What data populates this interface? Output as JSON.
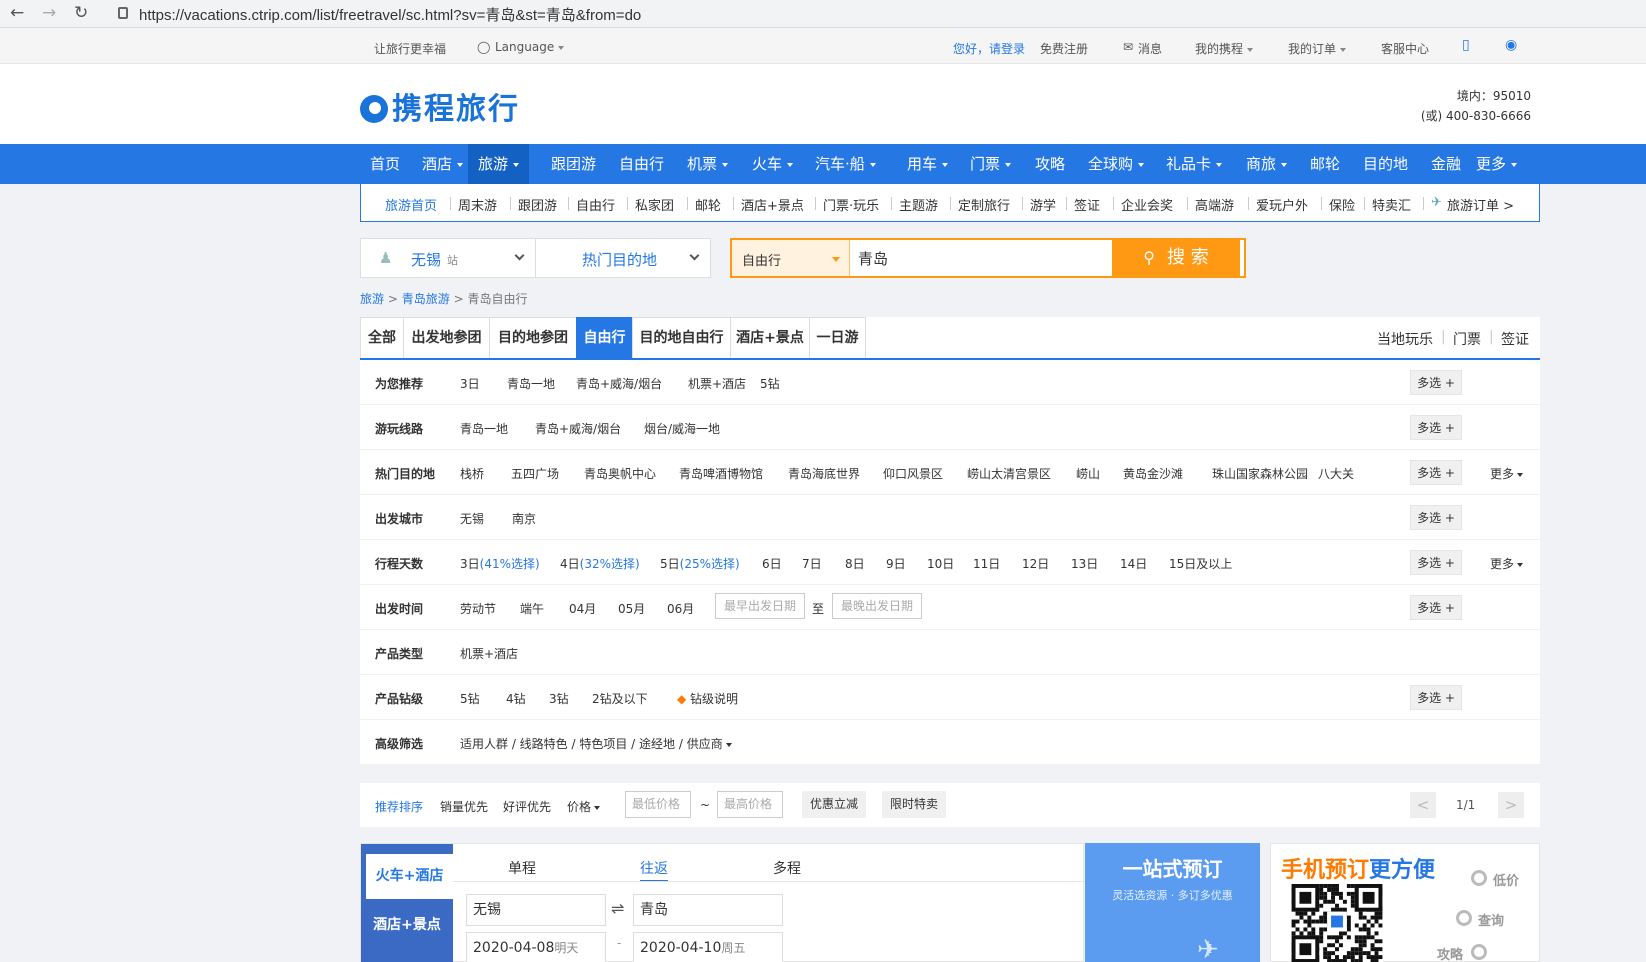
{
  "browser": {
    "url": "https://vacations.ctrip.com/list/freetravel/sc.html?sv=青岛&st=青岛&from=do"
  },
  "topbar": {
    "slogan": "让旅行更幸福",
    "language": "Language",
    "login": "您好，请登录",
    "register": "免费注册",
    "messages": "消息",
    "my_ctrip": "我的携程",
    "my_orders": "我的订单",
    "service": "客服中心"
  },
  "header": {
    "logo": "携程旅行",
    "phone_domestic": "境内：95010",
    "phone_alt": "(或) 400-830-6666"
  },
  "mainnav": {
    "items": [
      "首页",
      "酒店",
      "旅游",
      "跟团游",
      "自由行",
      "机票",
      "火车",
      "汽车·船",
      "用车",
      "门票",
      "攻略",
      "全球购",
      "礼品卡",
      "商旅",
      "邮轮",
      "目的地",
      "金融",
      "更多"
    ]
  },
  "subnav": {
    "items": [
      "旅游首页",
      "周末游",
      "跟团游",
      "自由行",
      "私家团",
      "邮轮",
      "酒店+景点",
      "门票·玩乐",
      "主题游",
      "定制旅行",
      "游学",
      "签证",
      "企业会奖",
      "高端游",
      "爱玩户外",
      "保险",
      "特卖汇",
      "旅游订单 >"
    ]
  },
  "search": {
    "city": "无锡",
    "city_suffix": "站",
    "hot_dest": "热门目的地",
    "type": "自由行",
    "query": "青岛",
    "button": "搜 索"
  },
  "breadcrumb": {
    "a": "旅游",
    "b": "青岛旅游",
    "c": "青岛自由行",
    "sep": ">"
  },
  "tabs": {
    "items": [
      "全部",
      "出发地参团",
      "目的地参团",
      "自由行",
      "目的地自由行",
      "酒店+景点",
      "一日游"
    ],
    "right": [
      "当地玩乐",
      "门票",
      "签证"
    ]
  },
  "filters": {
    "multi": "多选 +",
    "more": "更多",
    "to": "至",
    "date_start": "最早出发日期",
    "date_end": "最晚出发日期",
    "rows": [
      {
        "label": "为您推荐",
        "options": [
          "3日",
          "青岛一地",
          "青岛+威海/烟台",
          "机票+酒店",
          "5钻"
        ]
      },
      {
        "label": "游玩线路",
        "options": [
          "青岛一地",
          "青岛+威海/烟台",
          "烟台/威海一地"
        ]
      },
      {
        "label": "热门目的地",
        "options": [
          "栈桥",
          "五四广场",
          "青岛奥帆中心",
          "青岛啤酒博物馆",
          "青岛海底世界",
          "仰口风景区",
          "崂山太清宫景区",
          "崂山",
          "黄岛金沙滩",
          "珠山国家森林公园",
          "八大关"
        ]
      },
      {
        "label": "出发城市",
        "options": [
          "无锡",
          "南京"
        ]
      },
      {
        "label": "行程天数",
        "options": [
          "3日",
          "4日",
          "5日",
          "6日",
          "7日",
          "8日",
          "9日",
          "10日",
          "11日",
          "12日",
          "13日",
          "14日",
          "15日及以上"
        ],
        "pcts": [
          "(41%选择)",
          "(32%选择)",
          "(25%选择)"
        ]
      },
      {
        "label": "出发时间",
        "options": [
          "劳动节",
          "端午",
          "04月",
          "05月",
          "06月"
        ]
      },
      {
        "label": "产品类型",
        "options": [
          "机票+酒店"
        ]
      },
      {
        "label": "产品钻级",
        "options": [
          "5钻",
          "4钻",
          "3钻",
          "2钻及以下",
          "钻级说明"
        ]
      },
      {
        "label": "高级筛选",
        "options": [
          "适用人群 / 线路特色 / 特色项目 / 途经地 / 供应商"
        ]
      }
    ]
  },
  "sortbar": {
    "items": [
      "推荐排序",
      "销量优先",
      "好评优先",
      "价格"
    ],
    "min_price": "最低价格",
    "max_price": "最高价格",
    "tilde": "~",
    "tags": [
      "优惠立减",
      "限时特卖"
    ],
    "page": "1/1",
    "prev": "<",
    "next": ">"
  },
  "booking": {
    "side_a": "火车+酒店",
    "side_b": "酒店+景点",
    "trip_types": [
      "单程",
      "往返",
      "多程"
    ],
    "from": "无锡",
    "to": "青岛",
    "date1": "2020-04-08",
    "date1_note": "明天",
    "date2": "2020-04-10",
    "date2_note": "周五",
    "swap": "⇌",
    "dash": "-"
  },
  "promo": {
    "title": "一站式预订",
    "subtitle": "灵活选资源 · 多订多优惠"
  },
  "mobile": {
    "title_a": "手机预订",
    "title_b": "更方便",
    "steps": [
      "低价",
      "查询",
      "攻略"
    ]
  },
  "colors": {
    "brand_blue": "#2577e3",
    "orange": "#ff9913"
  }
}
